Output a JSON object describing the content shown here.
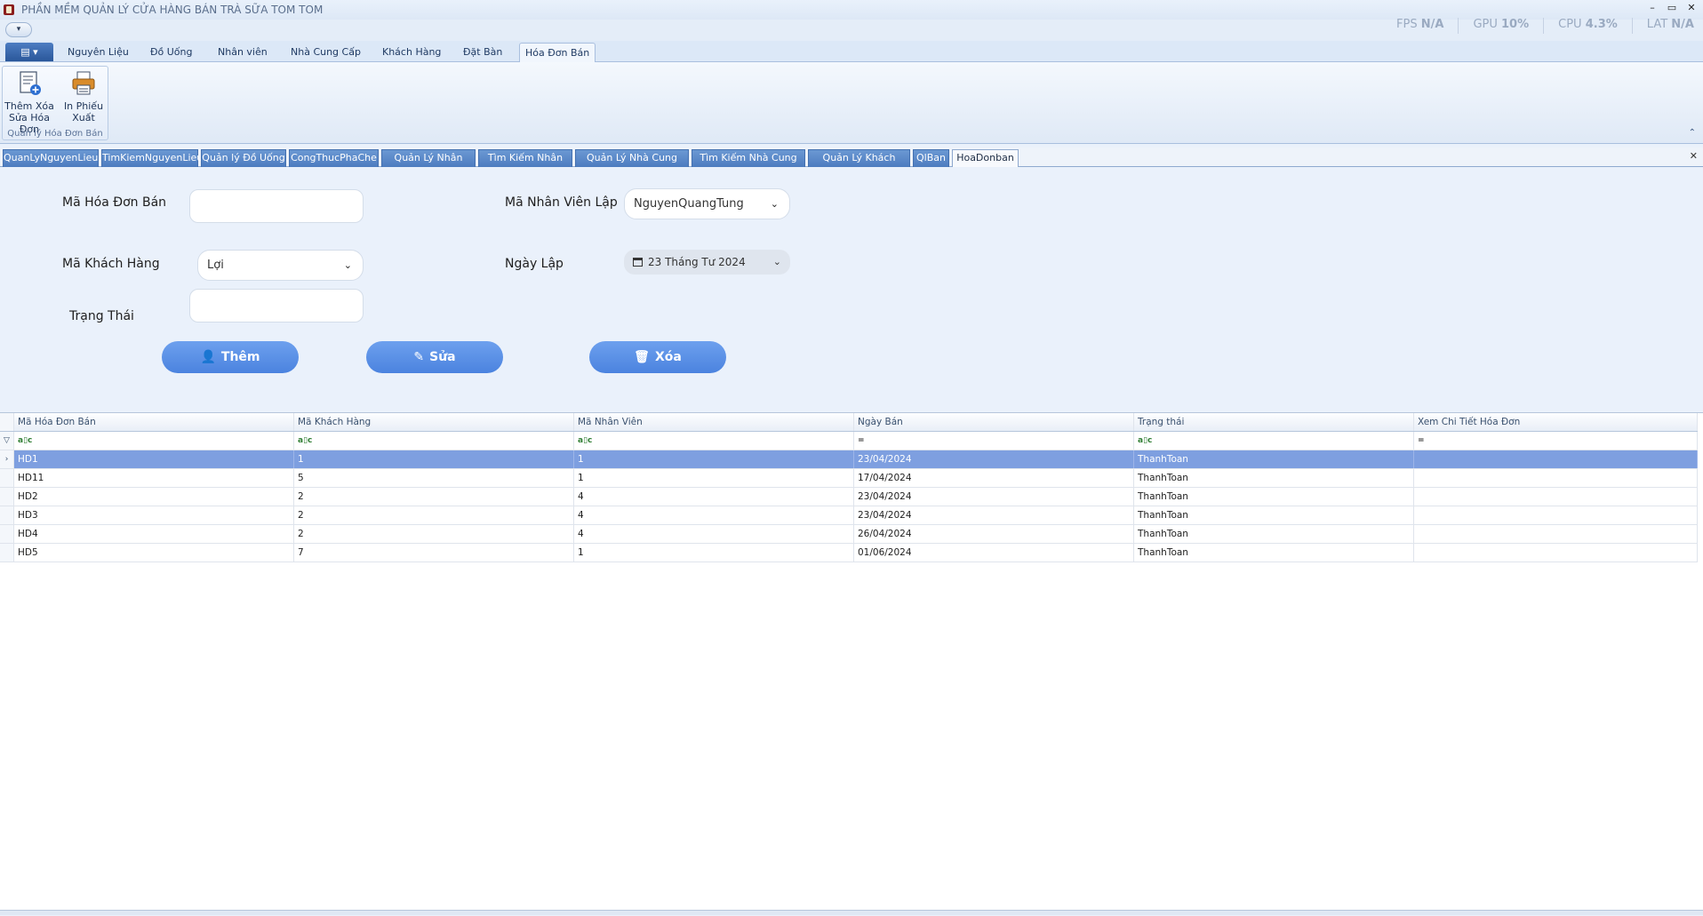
{
  "window": {
    "title": "PHẦN MỀM QUẢN LÝ CỬA HÀNG BÁN TRÀ SỮA TOM TOM",
    "controls": [
      "–",
      "▭",
      "✕"
    ]
  },
  "perf": {
    "fps_label": "FPS",
    "fps_value": "N/A",
    "gpu_label": "GPU",
    "gpu_value": "10%",
    "cpu_label": "CPU",
    "cpu_value": "4.3%",
    "lat_label": "LAT",
    "lat_value": "N/A"
  },
  "ribbon": {
    "tabs": [
      "Nguyên Liệu",
      "Đồ Uống",
      "Nhân viên",
      "Nhà Cung Cấp",
      "Khách Hàng",
      "Đặt Bàn",
      "Hóa Đơn Bán"
    ],
    "active_tab": "Hóa Đơn Bán",
    "group": {
      "label": "Quản lý Hóa Đơn Bán",
      "buttons": [
        {
          "line1": "Thêm Xóa",
          "line2": "Sửa Hóa Đơn"
        },
        {
          "line1": "In Phiếu",
          "line2": "Xuất"
        }
      ]
    }
  },
  "doc_tabs": [
    "QuanLyNguyenLieu",
    "TimKiemNguyenLieu",
    "Quản lý Đồ Uống",
    "CongThucPhaChe",
    "Quản Lý Nhân Viên",
    "Tìm Kiếm Nhân Viên",
    "Quản Lý Nhà Cung Cấp",
    "Tìm Kiếm Nhà Cung Cấp",
    "Quản Lý Khách Hàng",
    "QlBan",
    "HoaDonban"
  ],
  "form": {
    "ma_hoa_don_label": "Mã Hóa Đơn Bán",
    "ma_hoa_don_value": "",
    "ma_khach_hang_label": "Mã Khách Hàng",
    "ma_khach_hang_value": "Lợi",
    "trang_thai_label": "Trạng Thái",
    "trang_thai_value": "",
    "ma_nhan_vien_label": "Mã Nhân Viên Lập",
    "ma_nhan_vien_value": "NguyenQuangTung",
    "ngay_lap_label": "Ngày Lập",
    "ngay_lap_value": "23 Tháng Tư 2024",
    "btn_them": "Thêm",
    "btn_sua": "Sửa",
    "btn_xoa": "Xóa"
  },
  "grid": {
    "columns": [
      "Mã Hóa Đơn Bán",
      "Mã Khách Hàng",
      "Mã Nhân Viên",
      "Ngày Bán",
      "Trạng thái",
      "Xem Chi Tiết Hóa Đơn"
    ],
    "filter_symbols": [
      "a▯c",
      "a▯c",
      "a▯c",
      "=",
      "a▯c",
      "="
    ],
    "rows": [
      [
        "HD1",
        "1",
        "1",
        "23/04/2024",
        "ThanhToan",
        ""
      ],
      [
        "HD11",
        "5",
        "1",
        "17/04/2024",
        "ThanhToan",
        ""
      ],
      [
        "HD2",
        "2",
        "4",
        "23/04/2024",
        "ThanhToan",
        ""
      ],
      [
        "HD3",
        "2",
        "4",
        "23/04/2024",
        "ThanhToan",
        ""
      ],
      [
        "HD4",
        "2",
        "4",
        "26/04/2024",
        "ThanhToan",
        ""
      ],
      [
        "HD5",
        "7",
        "1",
        "01/06/2024",
        "ThanhToan",
        ""
      ]
    ],
    "selected_row": 0
  },
  "colors": {
    "accent": "#4b83df",
    "selected_row": "#7e9fe0",
    "tab_blue": "#4d7cbf",
    "background": "#eaf1fb"
  }
}
